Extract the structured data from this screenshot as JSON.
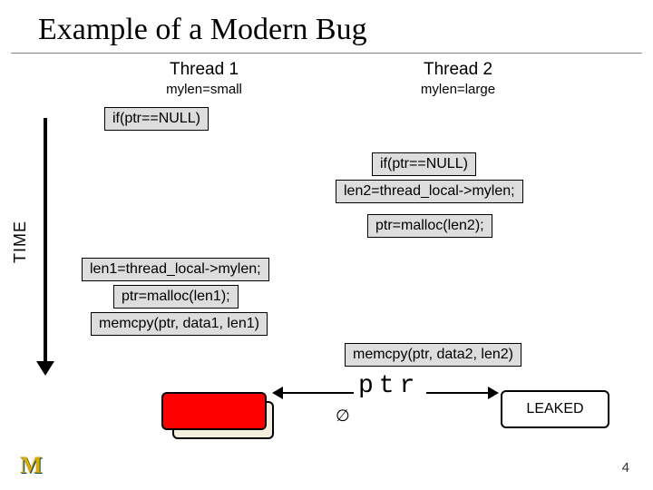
{
  "title": "Example of a Modern Bug",
  "thread1": {
    "header": "Thread 1",
    "sub": "mylen=small"
  },
  "thread2": {
    "header": "Thread 2",
    "sub": "mylen=large"
  },
  "time_label": "TIME",
  "t1": {
    "step1": "if(ptr==NULL)",
    "step2": "len1=thread_local->mylen;",
    "step3": "ptr=malloc(len1);",
    "step4": "memcpy(ptr, data1, len1)"
  },
  "t2": {
    "step1": "if(ptr==NULL)",
    "step2": "len2=thread_local->mylen;",
    "step3": "ptr=malloc(len2);",
    "step4": "memcpy(ptr, data2, len2)"
  },
  "ptr_label": "ptr",
  "null_sym": "∅",
  "leaked": "LEAKED",
  "logo": "M",
  "page": "4"
}
